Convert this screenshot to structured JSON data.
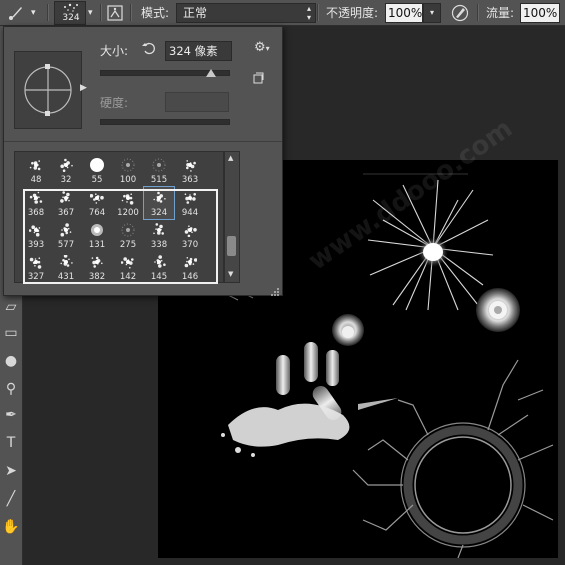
{
  "options_bar": {
    "brush_size_value": "324",
    "mode_label": "模式:",
    "mode_value": "正常",
    "opacity_label": "不透明度:",
    "opacity_value": "100%",
    "flow_label": "流量:",
    "flow_value": "100%"
  },
  "brush_panel": {
    "size_label": "大小:",
    "size_value": "324 像素",
    "size_slider_fraction": 0.86,
    "hardness_label": "硬度:",
    "hardness_value": "",
    "presets": [
      {
        "label": "48"
      },
      {
        "label": "32"
      },
      {
        "label": "55"
      },
      {
        "label": "100"
      },
      {
        "label": "515"
      },
      {
        "label": "363"
      },
      {
        "label": "368"
      },
      {
        "label": "367"
      },
      {
        "label": "764"
      },
      {
        "label": "1200"
      },
      {
        "label": "324"
      },
      {
        "label": "944"
      },
      {
        "label": "393"
      },
      {
        "label": "577"
      },
      {
        "label": "131"
      },
      {
        "label": "275"
      },
      {
        "label": "338"
      },
      {
        "label": "370"
      },
      {
        "label": "327"
      },
      {
        "label": "431"
      },
      {
        "label": "382"
      },
      {
        "label": "142"
      },
      {
        "label": "145"
      },
      {
        "label": "146"
      }
    ],
    "selected_preset": "324"
  },
  "tools": [
    {
      "name": "brush-tool-icon",
      "glyph": "✎"
    },
    {
      "name": "eraser-tool-icon",
      "glyph": "▱"
    },
    {
      "name": "gradient-tool-icon",
      "glyph": "▭"
    },
    {
      "name": "blur-tool-icon",
      "glyph": "●"
    },
    {
      "name": "dodge-tool-icon",
      "glyph": "⚲"
    },
    {
      "name": "pen-tool-icon",
      "glyph": "✒"
    },
    {
      "name": "type-tool-icon",
      "glyph": "T"
    },
    {
      "name": "path-selection-tool-icon",
      "glyph": "➤"
    },
    {
      "name": "line-tool-icon",
      "glyph": "╱"
    },
    {
      "name": "hand-tool-icon",
      "glyph": "✋"
    }
  ],
  "watermark": {
    "text": "www.ddooo.com"
  },
  "colors": {
    "panel_bg": "#535353",
    "canvas_bg": "#000000",
    "app_bg": "#282828"
  }
}
